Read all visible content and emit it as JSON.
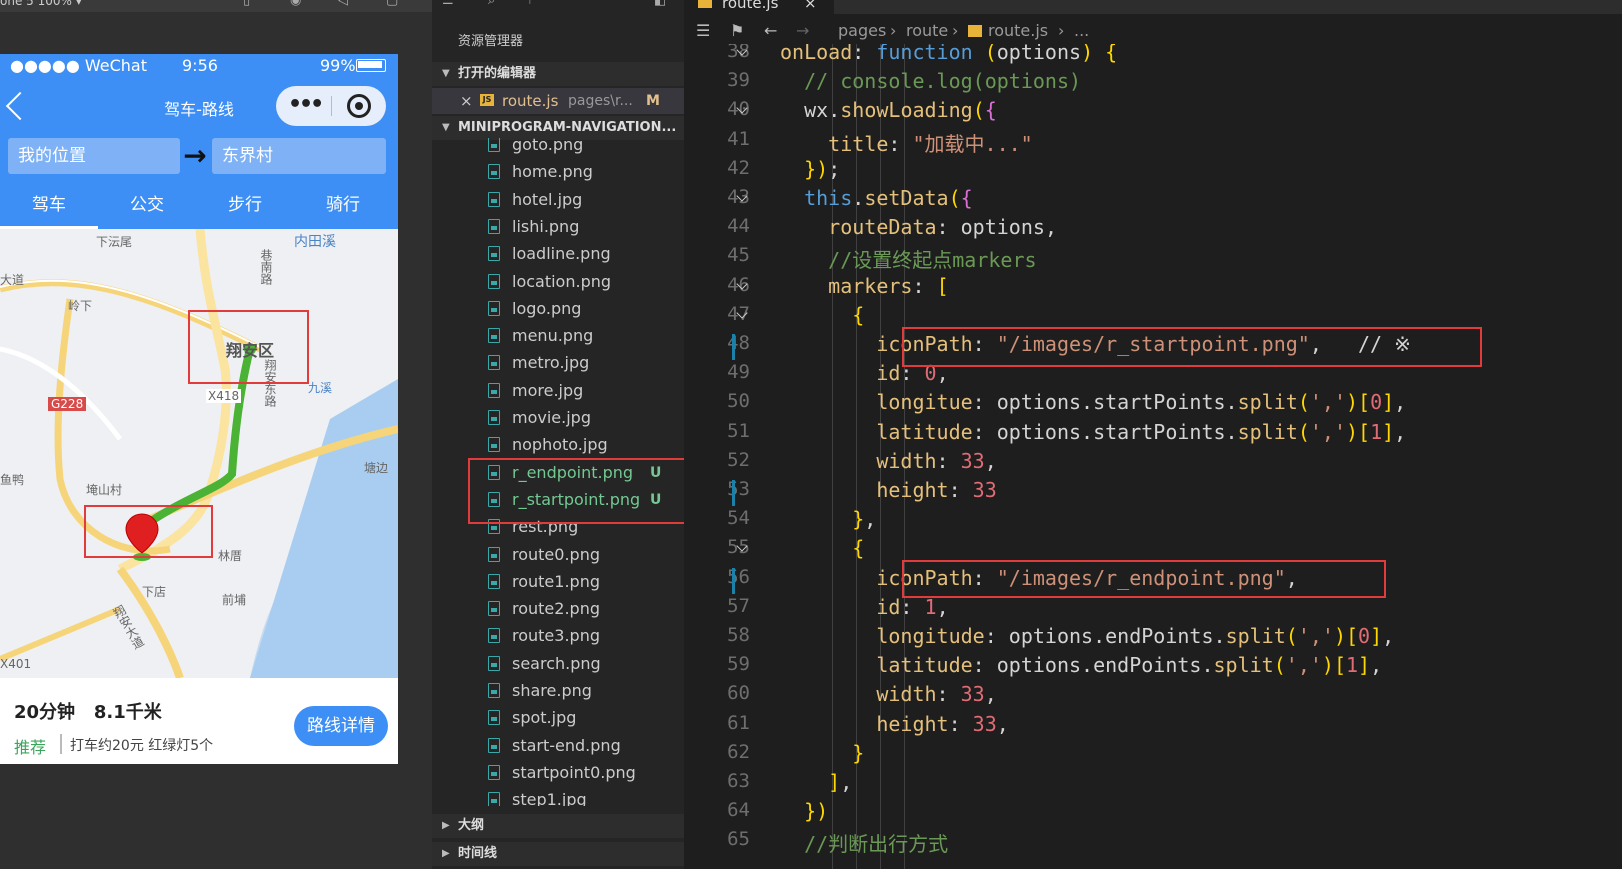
{
  "simulator": {
    "device_label": "one 5 100% ▾",
    "status": {
      "signal": "●●●●● WeChat",
      "time": "9:56",
      "battery": "99%"
    },
    "nav": {
      "title": "驾车-路线"
    },
    "route_input": {
      "from": "我的位置",
      "to": "东界村",
      "arrow": "→"
    },
    "tabs": [
      {
        "label": "驾车"
      },
      {
        "label": "公交"
      },
      {
        "label": "步行"
      },
      {
        "label": "骑行"
      }
    ],
    "map_labels": [
      "下沄尾",
      "内田溪",
      "巷南路",
      "大道",
      "岭下",
      "翔安区",
      "翔安东路",
      "九溪",
      "X418",
      "G228",
      "塘边",
      "鱼鸭",
      "埯山村",
      "林厝",
      "下店",
      "翔安大道",
      "前埔",
      "X401"
    ],
    "route_summary": {
      "text": "20分钟   8.1千米",
      "tag": "推荐",
      "extra": "打车约20元  红绿灯5个"
    },
    "detail_button": "路线详情"
  },
  "explorer": {
    "title": "资源管理器",
    "open_editors_header": "打开的编辑器",
    "open_editor": {
      "name": "route.js",
      "path": "pages\\r...",
      "status": "M"
    },
    "project_header": "MINIPROGRAM-NAVIGATION...",
    "files": [
      {
        "name": "goto.png",
        "status": ""
      },
      {
        "name": "home.png",
        "status": ""
      },
      {
        "name": "hotel.jpg",
        "status": ""
      },
      {
        "name": "lishi.png",
        "status": ""
      },
      {
        "name": "loadline.png",
        "status": ""
      },
      {
        "name": "location.png",
        "status": ""
      },
      {
        "name": "logo.png",
        "status": ""
      },
      {
        "name": "menu.png",
        "status": ""
      },
      {
        "name": "metro.jpg",
        "status": ""
      },
      {
        "name": "more.jpg",
        "status": ""
      },
      {
        "name": "movie.jpg",
        "status": ""
      },
      {
        "name": "nophoto.jpg",
        "status": ""
      },
      {
        "name": "r_endpoint.png",
        "status": "U"
      },
      {
        "name": "r_startpoint.png",
        "status": "U"
      },
      {
        "name": "rest.png",
        "status": ""
      },
      {
        "name": "route0.png",
        "status": ""
      },
      {
        "name": "route1.png",
        "status": ""
      },
      {
        "name": "route2.png",
        "status": ""
      },
      {
        "name": "route3.png",
        "status": ""
      },
      {
        "name": "search.png",
        "status": ""
      },
      {
        "name": "share.png",
        "status": ""
      },
      {
        "name": "spot.jpg",
        "status": ""
      },
      {
        "name": "start-end.png",
        "status": ""
      },
      {
        "name": "startpoint0.png",
        "status": ""
      },
      {
        "name": "step1.jpg",
        "status": ""
      }
    ],
    "outline_header": "大纲",
    "timeline_header": "时间线"
  },
  "editor": {
    "tab": {
      "name": "route.js",
      "close": "×"
    },
    "breadcrumb": [
      "pages",
      "route",
      "route.js",
      "..."
    ],
    "line_numbers": [
      "38",
      "39",
      "40",
      "41",
      "42",
      "43",
      "44",
      "45",
      "46",
      "47",
      "48",
      "49",
      "50",
      "51",
      "52",
      "53",
      "54",
      "55",
      "56",
      "57",
      "58",
      "59",
      "60",
      "61",
      "62",
      "63",
      "64",
      "65"
    ],
    "code_lines": [
      "onLoad: function (options) {",
      "  // console.log(options)",
      "  wx.showLoading({",
      "    title: \"加载中...\"",
      "  });",
      "  this.setData({",
      "    routeData: options,",
      "    //设置终起点markers",
      "    markers: [",
      "      {",
      "        iconPath: \"/images/r_startpoint.png\",   // ※",
      "        id: 0,",
      "        longitue: options.startPoints.split(',')[0],",
      "        latitude: options.startPoints.split(',')[1],",
      "        width: 33,",
      "        height: 33",
      "      },",
      "      {",
      "        iconPath: \"/images/r_endpoint.png\",",
      "        id: 1,",
      "        longitude: options.endPoints.split(',')[0],",
      "        latitude: options.endPoints.split(',')[1],",
      "        width: 33,",
      "        height: 33,",
      "      }",
      "    ],",
      "  })",
      "  //判断出行方式"
    ]
  },
  "colors": {
    "accent": "#3d8ff5",
    "highlight_box": "#e23b3b",
    "untracked": "#73c991"
  }
}
